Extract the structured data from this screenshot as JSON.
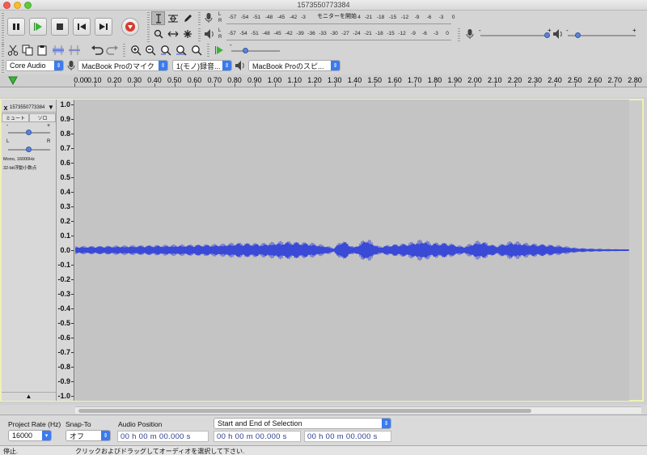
{
  "window": {
    "title": "1573550773384"
  },
  "meters": {
    "record_lr": [
      "L",
      "R"
    ],
    "play_lr": [
      "L",
      "R"
    ],
    "record_scale_left": [
      "-57",
      "-54",
      "-51",
      "-48",
      "-45",
      "-42",
      "-3"
    ],
    "record_monitor_text": "モニターを開始",
    "record_scale_right": [
      "-18",
      "-15",
      "-12",
      "-9",
      "-6",
      "-3",
      "0"
    ],
    "record_scale_right_prefix": [
      "4",
      "-21"
    ],
    "playback_scale": [
      "-57",
      "-54",
      "-51",
      "-48",
      "-45",
      "-42",
      "-39",
      "-36",
      "-33",
      "-30",
      "-27",
      "-24",
      "-21",
      "-18",
      "-15",
      "-12",
      "-9",
      "-6",
      "-3",
      "0"
    ]
  },
  "mixer": {
    "recording_minus": "-",
    "recording_plus": "+",
    "playback_minus": "-",
    "playback_plus": "+"
  },
  "devices": {
    "host": "Core Audio",
    "recording_device": "MacBook Proのマイク",
    "channels": "1(モノ)録音...",
    "playback_device": "MacBook Proのスピ..."
  },
  "timeline": {
    "ticks": [
      "0.00",
      "0.10",
      "0.20",
      "0.30",
      "0.40",
      "0.50",
      "0.60",
      "0.70",
      "0.80",
      "0.90",
      "1.00",
      "1.10",
      "1.20",
      "1.30",
      "1.40",
      "1.50",
      "1.60",
      "1.70",
      "1.80",
      "1.90",
      "2.00",
      "2.10",
      "2.20",
      "2.30",
      "2.40",
      "2.50",
      "2.60",
      "2.70",
      "2.80"
    ]
  },
  "track": {
    "close": "x",
    "name": "1573550773384",
    "mute": "ミュート",
    "solo": "ソロ",
    "gain_minus": "-",
    "gain_plus": "+",
    "pan_left": "L",
    "pan_right": "R",
    "info_line1": "Mono, 16000Hz",
    "info_line2": "32-bit浮動小数点",
    "collapse": "▲"
  },
  "vertical_ruler": [
    "1.0",
    "0.9",
    "0.8",
    "0.7",
    "0.6",
    "0.5",
    "0.4",
    "0.3",
    "0.2",
    "0.1",
    "0.0",
    "-0.1",
    "-0.2",
    "-0.3",
    "-0.4",
    "-0.5",
    "-0.6",
    "-0.7",
    "-0.8",
    "-0.9",
    "-1.0"
  ],
  "selection_toolbar": {
    "project_rate_label": "Project Rate (Hz)",
    "project_rate_value": "16000",
    "snap_to_label": "Snap-To",
    "snap_to_value": "オフ",
    "audio_position_label": "Audio Position",
    "audio_position_value": "00 h 00 m 00.000 s",
    "selection_mode": "Start and End of Selection",
    "selection_start": "00 h 00 m 00.000 s",
    "selection_end": "00 h 00 m 00.000 s"
  },
  "status": {
    "state": "停止.",
    "hint": "クリックおよびドラッグしてオーディオを選択して下さい."
  },
  "colors": {
    "waveform": "#3a49d6",
    "track_border": "#eef2b2",
    "accent": "#3b7bf0",
    "play_green": "#3ab53a",
    "stop_red": "#d63a2f"
  }
}
